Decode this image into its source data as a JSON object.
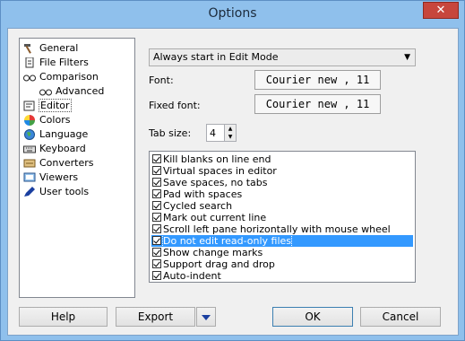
{
  "window": {
    "title": "Options",
    "close_glyph": "✕"
  },
  "sidebar": {
    "items": [
      {
        "label": "General",
        "icon": "hammer-icon"
      },
      {
        "label": "File Filters",
        "icon": "document-icon"
      },
      {
        "label": "Comparison",
        "icon": "glasses-icon"
      },
      {
        "label": "Advanced",
        "icon": "glasses-icon"
      },
      {
        "label": "Editor",
        "icon": "editor-icon"
      },
      {
        "label": "Colors",
        "icon": "color-wheel-icon"
      },
      {
        "label": "Language",
        "icon": "globe-icon"
      },
      {
        "label": "Keyboard",
        "icon": "keyboard-icon"
      },
      {
        "label": "Converters",
        "icon": "converter-icon"
      },
      {
        "label": "Viewers",
        "icon": "viewer-icon"
      },
      {
        "label": "User tools",
        "icon": "pen-icon"
      }
    ],
    "selected": "Editor"
  },
  "editor": {
    "start_mode": "Always start in Edit Mode",
    "font_label": "Font:",
    "font_value": "Courier new , 11",
    "fixed_font_label": "Fixed font:",
    "fixed_font_value": "Courier new , 11",
    "tab_size_label": "Tab size:",
    "tab_size_value": "4",
    "options": [
      {
        "label": "Kill blanks on line end",
        "checked": true
      },
      {
        "label": "Virtual spaces in editor",
        "checked": true
      },
      {
        "label": "Save spaces, no tabs",
        "checked": true
      },
      {
        "label": "Pad with spaces",
        "checked": true
      },
      {
        "label": "Cycled search",
        "checked": true
      },
      {
        "label": "Mark out current line",
        "checked": true
      },
      {
        "label": "Scroll left pane horizontally with mouse wheel",
        "checked": true
      },
      {
        "label": "Do not edit read-only files",
        "checked": true,
        "highlighted": true
      },
      {
        "label": "Show change marks",
        "checked": true
      },
      {
        "label": "Support drag and drop",
        "checked": true
      },
      {
        "label": "Auto-indent",
        "checked": true
      }
    ]
  },
  "buttons": {
    "help": "Help",
    "export": "Export",
    "ok": "OK",
    "cancel": "Cancel"
  }
}
